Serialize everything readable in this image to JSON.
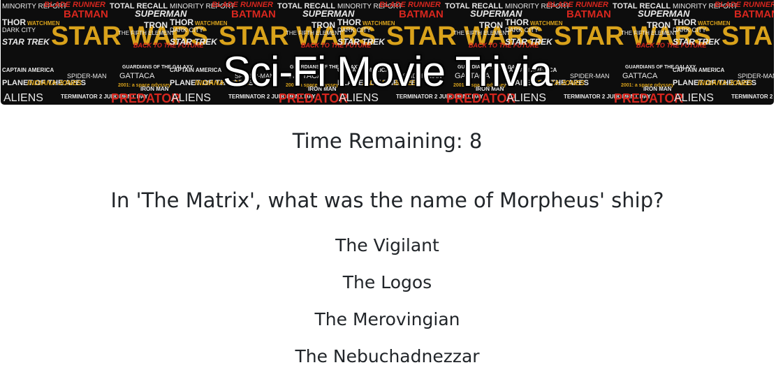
{
  "banner": {
    "title": "Sci-Fi Movie Trivia",
    "logo_tiles": [
      "MINORITY REPORT",
      "BLADE RUNNER",
      "TOTAL RECALL",
      "SUPERMAN",
      "BATMAN",
      "THOR",
      "WATCHMEN",
      "STAR WARS",
      "DARK CITY",
      "TRON",
      "THE FIFTH ELEMENT",
      "STAR TREK",
      "BACK TO THE FUTURE",
      "CAPTAIN AMERICA",
      "GUARDIANS OF THE GALAXY",
      "SPIDER-MAN",
      "GATTACA",
      "2001: a space odyssey",
      "PLANET OF THE APES",
      "INDIANA JONES",
      "IRON MAN",
      "ALIENS",
      "TERMINATOR 2 JUDGMENT DAY",
      "PREDATOR"
    ]
  },
  "timer": {
    "text": "Time Remaining: 8"
  },
  "question": {
    "text": "In 'The Matrix', what was the name of Morpheus' ship?"
  },
  "answers": [
    "The Vigilant",
    "The Logos",
    "The Merovingian",
    "The Nebuchadnezzar"
  ],
  "colors": {
    "banner_background": "#0d0d0d",
    "logo_gold": "#d9a21b",
    "logo_red": "#d7261e",
    "logo_white": "#e8e8e8",
    "text": "#212529"
  }
}
